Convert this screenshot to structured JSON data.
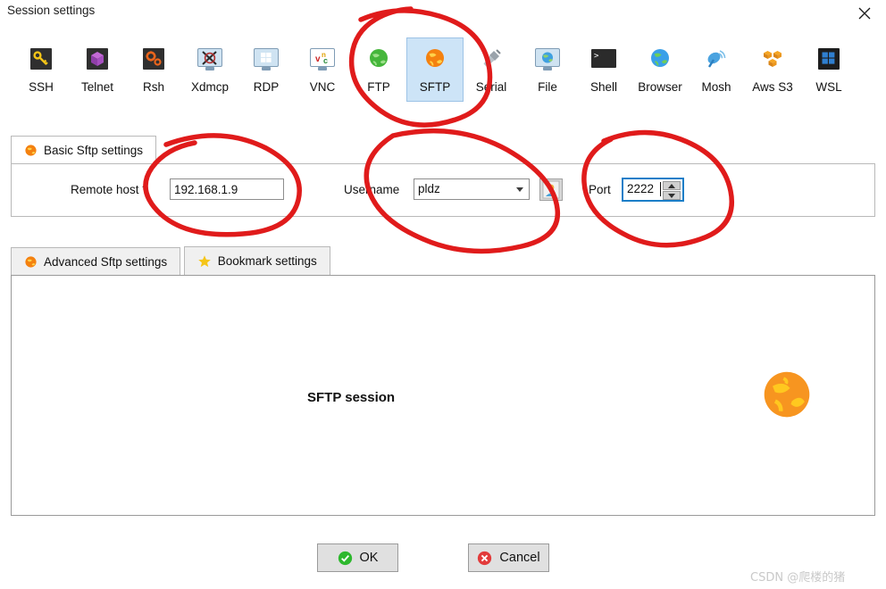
{
  "window": {
    "title": "Session settings",
    "close_icon": "close-icon"
  },
  "toolbar": {
    "selected": "SFTP",
    "items": [
      {
        "label": "SSH",
        "icon": "key-icon"
      },
      {
        "label": "Telnet",
        "icon": "cube-icon"
      },
      {
        "label": "Rsh",
        "icon": "gears-icon"
      },
      {
        "label": "Xdmcp",
        "icon": "x-monitor-icon"
      },
      {
        "label": "RDP",
        "icon": "windows-monitor-icon"
      },
      {
        "label": "VNC",
        "icon": "vnc-monitor-icon"
      },
      {
        "label": "FTP",
        "icon": "green-globe-icon"
      },
      {
        "label": "SFTP",
        "icon": "orange-globe-icon"
      },
      {
        "label": "Serial",
        "icon": "serial-plug-icon"
      },
      {
        "label": "File",
        "icon": "file-monitor-icon"
      },
      {
        "label": "Shell",
        "icon": "terminal-icon"
      },
      {
        "label": "Browser",
        "icon": "blue-globe-icon"
      },
      {
        "label": "Mosh",
        "icon": "satellite-dish-icon"
      },
      {
        "label": "Aws S3",
        "icon": "aws-cubes-icon"
      },
      {
        "label": "WSL",
        "icon": "windows-icon"
      }
    ]
  },
  "basic_tab": {
    "label": "Basic Sftp settings",
    "icon": "orange-globe-icon",
    "fields": {
      "remote_host_label": "Remote host *",
      "remote_host_value": "192.168.1.9",
      "remote_host_placeholder": "Remote host",
      "username_label": "Username",
      "username_value": "pldz",
      "username_placeholder": "Username",
      "user_button_icon": "user-icon",
      "port_label": "Port",
      "port_value": "2222",
      "spinner_up_icon": "spinner-up-icon",
      "spinner_down_icon": "spinner-down-icon",
      "dropdown_icon": "chevron-down-icon"
    }
  },
  "secondary_tabs": [
    {
      "label": "Advanced Sftp settings",
      "icon": "orange-globe-icon",
      "active": false
    },
    {
      "label": "Bookmark settings",
      "icon": "star-icon",
      "active": false
    }
  ],
  "content_panel": {
    "session_label": "SFTP session",
    "session_icon": "orange-globe-icon"
  },
  "footer": {
    "ok_label": "OK",
    "ok_icon": "check-circle-icon",
    "cancel_label": "Cancel",
    "cancel_icon": "x-circle-icon"
  },
  "watermark": {
    "text": "CSDN @爬楼的猪"
  },
  "colors": {
    "selection_bg": "#cde4f7",
    "selection_border": "#9dc3e6",
    "focus_border": "#1b7ec8",
    "annotation": "#e01b1b",
    "ok_green": "#2eb82e",
    "cancel_red": "#e23b3b",
    "sftp_orange": "#f79520"
  },
  "annotations": {
    "description": "hand-drawn red circles",
    "circles": [
      "sftp-toolbar-item",
      "remote-host-field",
      "username-field",
      "port-field"
    ]
  }
}
